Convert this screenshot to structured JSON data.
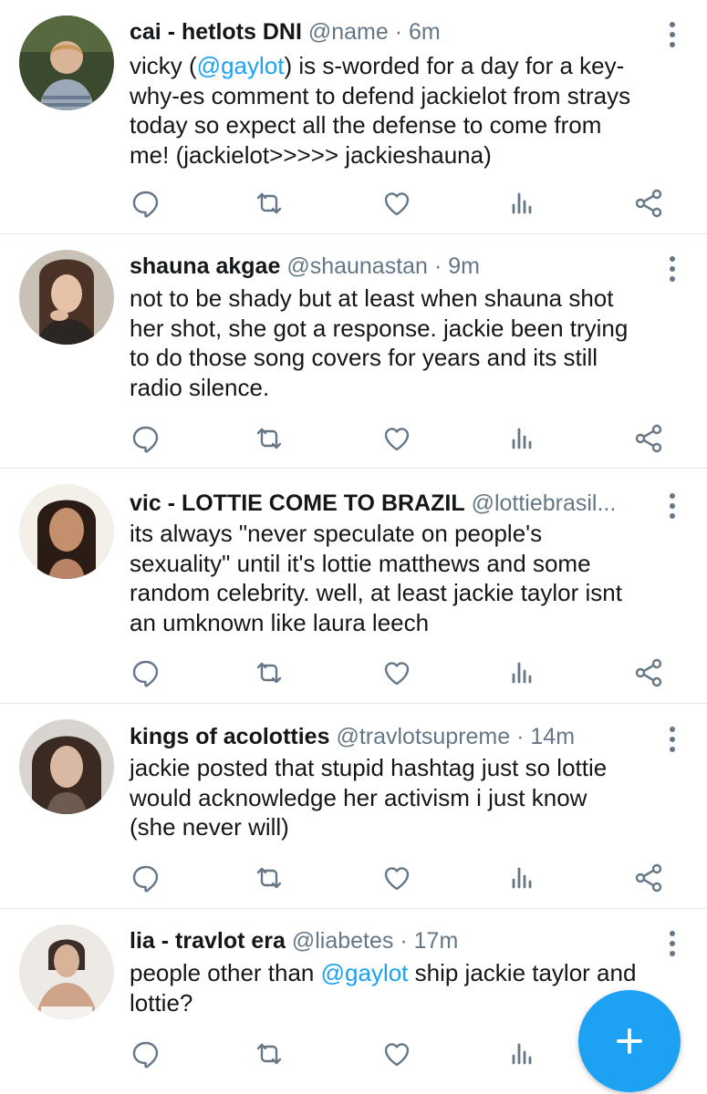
{
  "tweets": [
    {
      "name": "cai - hetlots DNI",
      "handle": "@name",
      "dot": "·",
      "time": "6m",
      "text": {
        "l1a": "vicky (",
        "l1m": "@gaylot",
        "l1b": ")  is s-worded for a day  for a key-",
        "l2": "why-es comment to defend jackielot from strays",
        "l3": "today  so expect all the defense to come from",
        "l4": "me! (jackielot>>>>> jackieshauna)"
      }
    },
    {
      "name": "shauna akgae",
      "handle": "@shaunastan",
      "dot": "·",
      "time": "9m",
      "text": {
        "l1": "not to be shady but at least when shauna shot",
        "l2": "her shot, she got a response. jackie been trying",
        "l3": "to do those song covers for years and its still",
        "l4": "radio silence."
      }
    },
    {
      "name": "vic - LOTTIE COME TO BRAZIL",
      "handle": "@lottiebrasil...",
      "dot": "",
      "time": "",
      "text": {
        "l1": "its always \"never speculate on people's",
        "l2": "sexuality\" until it's lottie matthews and some",
        "l3": "random celebrity. well, at least jackie taylor isnt",
        "l4": "an umknown like laura leech"
      }
    },
    {
      "name": "kings of acolotties",
      "handle": "@travlotsupreme",
      "dot": "·",
      "time": "14m",
      "text": {
        "l1": "jackie posted that stupid hashtag just so lottie",
        "l2": "would acknowledge her activism i just know",
        "l3": "(she never will)"
      }
    },
    {
      "name": "lia - travlot era",
      "handle": "@liabetes",
      "dot": "·",
      "time": "17m",
      "text": {
        "l1a": "people other than ",
        "l1m": "@gaylot",
        "l1b": " ship jackie taylor and",
        "l2": "lottie?"
      }
    }
  ],
  "icons": {
    "reply": "reply-icon",
    "retweet": "retweet-icon",
    "like": "heart-icon",
    "analytics": "analytics-icon",
    "share": "share-icon",
    "more": "more-vertical-icon",
    "compose": "compose-plus-icon"
  },
  "colors": {
    "accent": "#1da1f2",
    "icon": "#657786",
    "text": "#14171a",
    "divider": "#e1e8ed"
  }
}
